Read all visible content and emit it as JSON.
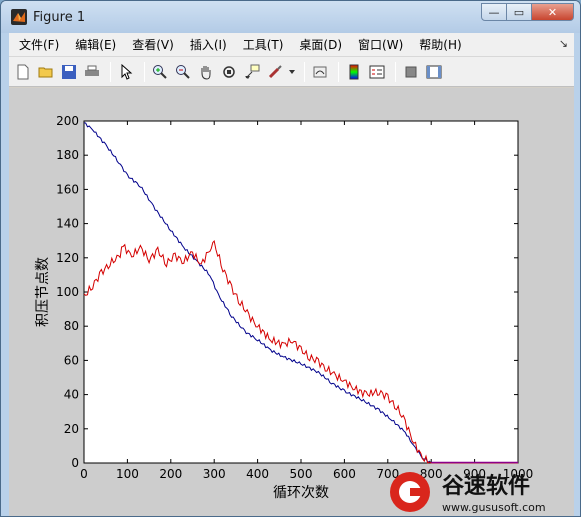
{
  "window": {
    "title": "Figure 1",
    "minimize_label": "—",
    "maximize_label": "▭",
    "close_label": "✕"
  },
  "menu": {
    "items": [
      "文件(F)",
      "编辑(E)",
      "查看(V)",
      "插入(I)",
      "工具(T)",
      "桌面(D)",
      "窗口(W)",
      "帮助(H)"
    ]
  },
  "toolbar": {
    "icons": [
      "new-file-icon",
      "open-folder-icon",
      "save-icon",
      "print-icon",
      "pointer-icon",
      "zoom-in-icon",
      "zoom-out-icon",
      "pan-hand-icon",
      "rotate-3d-icon",
      "data-cursor-icon",
      "brush-icon",
      "link-icon",
      "colorbar-icon",
      "legend-icon",
      "hide-plot-tools-icon",
      "show-plot-tools-icon"
    ]
  },
  "chart_data": {
    "type": "line",
    "xlabel": "循环次数",
    "ylabel": "积压节点数",
    "xlim": [
      0,
      1000
    ],
    "ylim": [
      0,
      200
    ],
    "xticks": [
      0,
      100,
      200,
      300,
      400,
      500,
      600,
      700,
      800,
      900,
      1000
    ],
    "yticks": [
      0,
      20,
      40,
      60,
      80,
      100,
      120,
      140,
      160,
      180,
      200
    ],
    "series": [
      {
        "color": "#00008b",
        "x": [
          0,
          20,
          50,
          80,
          100,
          130,
          160,
          200,
          230,
          260,
          290,
          310,
          340,
          370,
          400,
          430,
          460,
          500,
          540,
          570,
          600,
          640,
          680,
          710,
          740,
          760,
          780,
          800,
          850,
          900,
          950,
          1000
        ],
        "y": [
          199,
          195,
          186,
          176,
          168,
          162,
          150,
          136,
          126,
          118,
          110,
          98,
          86,
          77,
          72,
          66,
          62,
          58,
          53,
          47,
          42,
          37,
          31,
          25,
          18,
          10,
          3,
          0,
          0,
          0,
          0,
          0
        ]
      },
      {
        "color": "#d40000",
        "x": [
          0,
          20,
          40,
          60,
          80,
          90,
          110,
          130,
          150,
          170,
          190,
          210,
          230,
          250,
          270,
          290,
          300,
          320,
          340,
          360,
          380,
          400,
          430,
          460,
          480,
          500,
          520,
          540,
          560,
          580,
          600,
          620,
          650,
          680,
          700,
          720,
          740,
          760,
          780,
          800,
          850,
          900,
          950,
          1000
        ],
        "y": [
          97,
          104,
          111,
          117,
          120,
          127,
          121,
          126,
          119,
          124,
          117,
          121,
          118,
          123,
          116,
          125,
          128,
          114,
          102,
          94,
          86,
          80,
          72,
          69,
          72,
          66,
          62,
          59,
          55,
          51,
          48,
          44,
          40,
          42,
          38,
          33,
          24,
          12,
          3,
          0,
          0,
          0,
          0,
          0
        ]
      }
    ]
  },
  "watermark": {
    "brand": "谷速软件",
    "url": "www.gususoft.com"
  }
}
